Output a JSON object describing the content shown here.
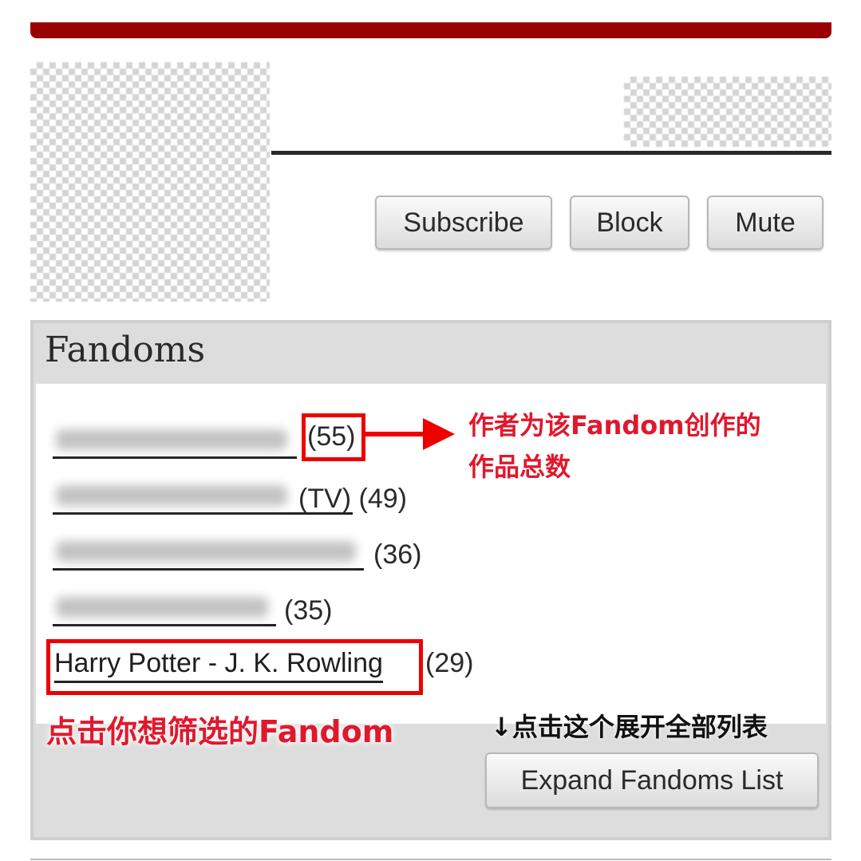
{
  "header": {
    "accent_color": "#990000"
  },
  "profile": {
    "buttons": {
      "subscribe": "Subscribe",
      "block": "Block",
      "mute": "Mute"
    }
  },
  "fandoms": {
    "title": "Fandoms",
    "items": [
      {
        "name_blurred": true,
        "suffix": "(55)"
      },
      {
        "name_blurred": true,
        "suffix": "(TV) (49)"
      },
      {
        "name_blurred": true,
        "suffix": "(36)"
      },
      {
        "name_blurred": true,
        "suffix": "(35)"
      },
      {
        "name": "Harry Potter - J. K. Rowling",
        "suffix": "(29)"
      }
    ],
    "expand_label": "Expand Fandoms List"
  },
  "annotations": {
    "count_note_line1": "作者为该Fandom创作的",
    "count_note_line2": "作品总数",
    "click_fandom_note": "点击你想筛选的Fandom",
    "expand_note": "↓点击这个展开全部列表",
    "highlight_color": "#ee0000"
  }
}
